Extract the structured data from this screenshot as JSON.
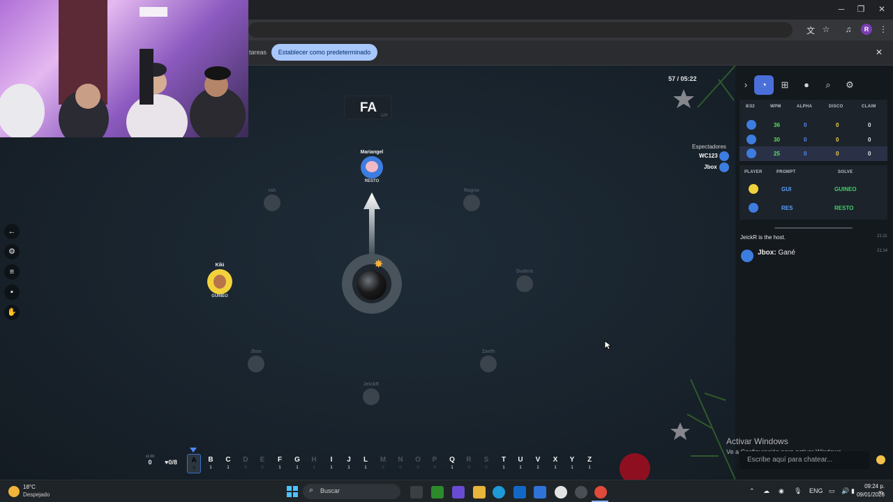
{
  "browser": {
    "infobar_text": "tareas",
    "set_default_label": "Establecer como predeterminado",
    "profile_initial": "R"
  },
  "game": {
    "top_counter": "57",
    "timer": "05:22",
    "syllable": "FA",
    "syllable_count": "12K",
    "players_active": [
      {
        "name": "Mariangel",
        "word": "RESTO"
      },
      {
        "name": "Kiki",
        "word": "GUINEO"
      }
    ],
    "players_dim": [
      {
        "name": "rah",
        "word": ""
      },
      {
        "name": "Ragno",
        "word": ""
      },
      {
        "name": "Dudera",
        "word": ""
      },
      {
        "name": "Jbox",
        "word": ""
      },
      {
        "name": "Zaeth",
        "word": ""
      },
      {
        "name": "JeickR",
        "word": ""
      }
    ],
    "spectators_title": "Espectadores",
    "spectators": [
      "WC123",
      "Jbox"
    ],
    "multiplier_top": "x1.00",
    "multiplier_val": "0",
    "lives": "♥0/8",
    "letters": [
      {
        "ch": "A",
        "ct": "0",
        "state": "sel"
      },
      {
        "ch": "B",
        "ct": "1",
        "state": "on"
      },
      {
        "ch": "C",
        "ct": "1",
        "state": "on"
      },
      {
        "ch": "D",
        "ct": "0",
        "state": "off"
      },
      {
        "ch": "E",
        "ct": "0",
        "state": "off"
      },
      {
        "ch": "F",
        "ct": "1",
        "state": "on"
      },
      {
        "ch": "G",
        "ct": "1",
        "state": "on"
      },
      {
        "ch": "H",
        "ct": "1",
        "state": "off"
      },
      {
        "ch": "I",
        "ct": "1",
        "state": "on"
      },
      {
        "ch": "J",
        "ct": "1",
        "state": "on"
      },
      {
        "ch": "L",
        "ct": "1",
        "state": "on"
      },
      {
        "ch": "M",
        "ct": "0",
        "state": "off"
      },
      {
        "ch": "N",
        "ct": "0",
        "state": "off"
      },
      {
        "ch": "O",
        "ct": "0",
        "state": "off"
      },
      {
        "ch": "P",
        "ct": "0",
        "state": "off"
      },
      {
        "ch": "Q",
        "ct": "1",
        "state": "on"
      },
      {
        "ch": "R",
        "ct": "0",
        "state": "off"
      },
      {
        "ch": "S",
        "ct": "0",
        "state": "off"
      },
      {
        "ch": "T",
        "ct": "1",
        "state": "on"
      },
      {
        "ch": "U",
        "ct": "1",
        "state": "on"
      },
      {
        "ch": "V",
        "ct": "1",
        "state": "on"
      },
      {
        "ch": "X",
        "ct": "1",
        "state": "on"
      },
      {
        "ch": "Y",
        "ct": "1",
        "state": "on"
      },
      {
        "ch": "Z",
        "ct": "1",
        "state": "on"
      }
    ]
  },
  "panel": {
    "stats_headers": [
      "8/32",
      "WPM",
      "ALPHA",
      "DISCO",
      "CLAIM"
    ],
    "stats_rows": [
      [
        "36",
        "0",
        "0",
        "0"
      ],
      [
        "30",
        "0",
        "0",
        "0"
      ],
      [
        "25",
        "0",
        "0",
        "0"
      ]
    ],
    "prompt_headers": [
      "PLAYER",
      "PROMPT",
      "SOLVE"
    ],
    "prompt_rows": [
      {
        "prompt": "GUI",
        "solve": "GUINEO"
      },
      {
        "prompt": "RES",
        "solve": "RESTO"
      }
    ],
    "chat": [
      {
        "text": "JeickR is the host.",
        "time": "21:11"
      },
      {
        "user": "Jbox:",
        "text": "Gané",
        "time": "21:14"
      }
    ],
    "chat_placeholder": "Escribe aquí para chatear...",
    "activate_title": "Activar Windows",
    "activate_sub": "Ve a Configuración para activar Windows."
  },
  "taskbar": {
    "temp": "18°C",
    "weather": "Despejado",
    "search": "Buscar",
    "lang": "ENG",
    "time": "09:24 p. m.",
    "date": "09/01/2026"
  },
  "colors": {
    "accent": "#4b6fd8",
    "wpm_green": "#5fe06a",
    "zero_blue": "#4f8cff",
    "zero_yellow": "#f3d34a",
    "prompt_blue": "#5aa2ff",
    "solve_green": "#3fd36a"
  }
}
